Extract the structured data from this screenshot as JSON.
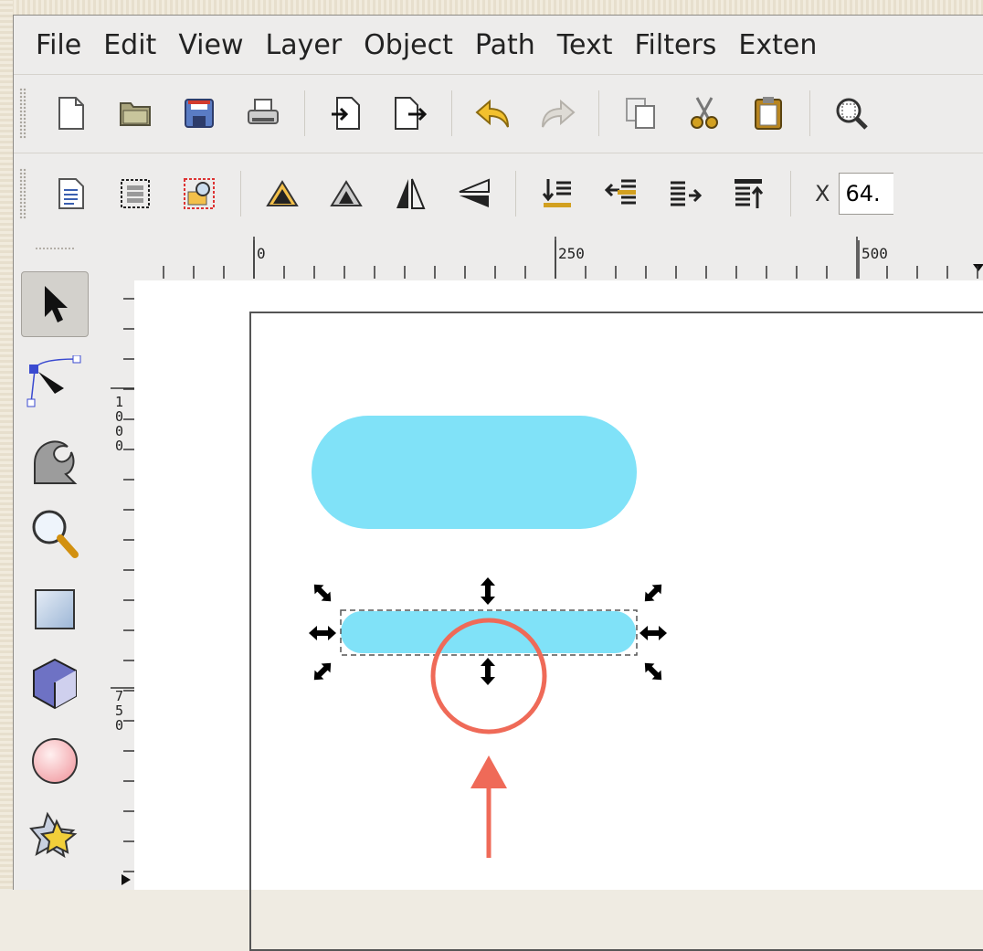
{
  "menu": [
    "File",
    "Edit",
    "View",
    "Layer",
    "Object",
    "Path",
    "Text",
    "Filters",
    "Exten"
  ],
  "toolbar_x": {
    "label": "X",
    "value": "64."
  },
  "ruler": {
    "h_labels": [
      "0",
      "250",
      "500"
    ],
    "v_labels": [
      "1000",
      "750"
    ]
  },
  "icons_toolbar1": [
    "new-document-icon",
    "open-folder-icon",
    "save-icon",
    "print-icon",
    "import-icon",
    "export-icon",
    "undo-icon",
    "redo-icon",
    "duplicate-icon",
    "cut-icon",
    "paste-icon",
    "zoom-icon"
  ],
  "icons_toolbar2": [
    "document-properties-icon",
    "select-all-icon",
    "select-in-all-layers-icon",
    "rotate-ccw-icon",
    "rotate-cw-icon",
    "flip-horizontal-icon",
    "flip-vertical-icon",
    "lower-to-bottom-icon",
    "lower-icon",
    "raise-icon",
    "raise-to-top-icon"
  ],
  "tools": [
    "selector-tool",
    "node-tool",
    "tweak-tool",
    "zoom-tool",
    "rectangle-tool",
    "box3d-tool",
    "ellipse-tool",
    "star-tool"
  ],
  "colors": {
    "shape_fill": "#80e2f8",
    "annotation": "#ef6a58",
    "handle": "#000000"
  }
}
